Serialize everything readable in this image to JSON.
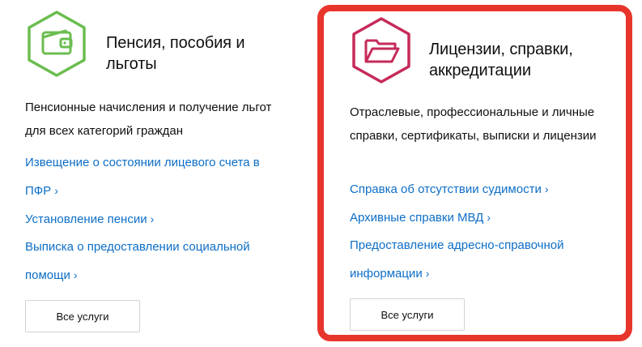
{
  "cards": [
    {
      "icon": "wallet-icon",
      "accent": "#6bbd4f",
      "title": "Пенсия, пособия и льготы",
      "description": "Пенсионные начисления и получение льгот для всех категорий граждан",
      "links": [
        "Извещение о состоянии лицевого счета в ПФР",
        "Установление пенсии",
        "Выписка о предоставлении социальной помощи"
      ],
      "all_services_label": "Все услуги"
    },
    {
      "icon": "folder-icon",
      "accent": "#c62a59",
      "highlight_border": "#e8352c",
      "title": "Лицензии, справки, аккредитации",
      "description": "Отраслевые, профессиональные и личные справки, сертификаты, выписки и лицензии",
      "links": [
        "Справка об отсутствии судимости",
        "Архивные справки МВД",
        "Предоставление адресно-справочной информации"
      ],
      "all_services_label": "Все услуги"
    }
  ],
  "link_chevron": "›"
}
